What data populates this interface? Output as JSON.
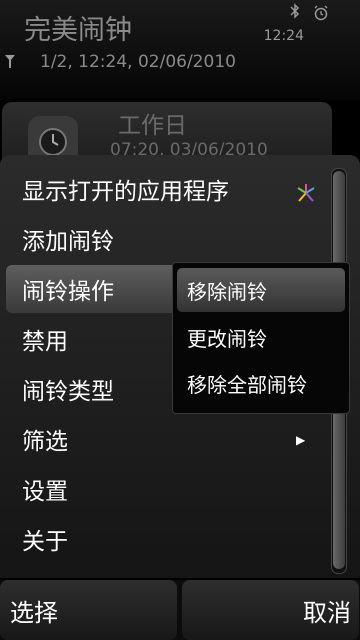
{
  "status": {
    "app_title": "完美闹钟",
    "clock": "12:24",
    "subtitle": "1/2, 12:24, 02/06/2010",
    "icons": [
      "signal-icon",
      "bluetooth-icon",
      "alarm-icon"
    ]
  },
  "alarm_item": {
    "name": "工作日",
    "time": "07:20, 03/06/2010"
  },
  "menu": {
    "items": [
      {
        "label": "显示打开的应用程序",
        "icon": "app-switch-icon"
      },
      {
        "label": "添加闹铃"
      },
      {
        "label": "闹铃操作",
        "selected": true
      },
      {
        "label": "禁用"
      },
      {
        "label": "闹铃类型"
      },
      {
        "label": "筛选",
        "has_submenu": true
      },
      {
        "label": "设置"
      },
      {
        "label": "关于"
      }
    ]
  },
  "submenu": {
    "items": [
      {
        "label": "移除闹铃",
        "selected": true
      },
      {
        "label": "更改闹铃"
      },
      {
        "label": "移除全部闹铃"
      }
    ]
  },
  "softkeys": {
    "left": "选择",
    "right": "取消"
  },
  "colors": {
    "background": "#000000",
    "menu_bg": "#222222",
    "highlight": "#4a4a4a",
    "dim_text": "#8a8a8a"
  }
}
